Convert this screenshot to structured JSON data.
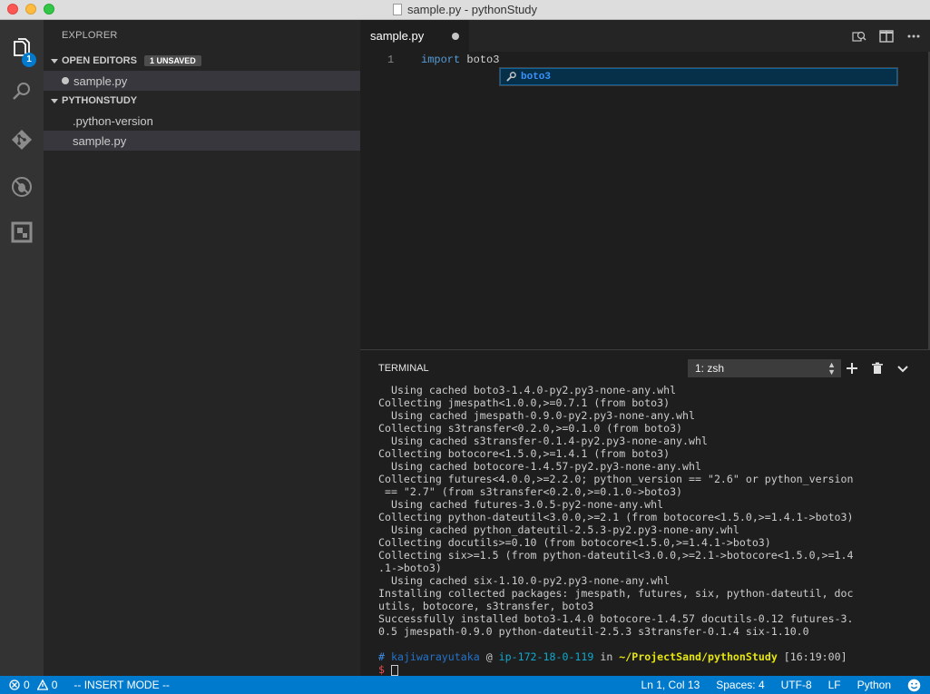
{
  "window": {
    "title": "sample.py - pythonStudy"
  },
  "activity_bar": {
    "explorer_badge": "1"
  },
  "sidebar": {
    "title": "EXPLORER",
    "open_editors": {
      "label": "OPEN EDITORS",
      "badge": "1 UNSAVED",
      "files": [
        "sample.py"
      ]
    },
    "project": {
      "label": "PYTHONSTUDY",
      "files": [
        ".python-version",
        "sample.py"
      ]
    }
  },
  "editor": {
    "tab_label": "sample.py",
    "line_number": "1",
    "code_keyword": "import",
    "code_rest": " boto3",
    "suggestion": "boto3"
  },
  "terminal": {
    "title": "TERMINAL",
    "selected_shell": "1: zsh",
    "output": "  Using cached boto3-1.4.0-py2.py3-none-any.whl\nCollecting jmespath<1.0.0,>=0.7.1 (from boto3)\n  Using cached jmespath-0.9.0-py2.py3-none-any.whl\nCollecting s3transfer<0.2.0,>=0.1.0 (from boto3)\n  Using cached s3transfer-0.1.4-py2.py3-none-any.whl\nCollecting botocore<1.5.0,>=1.4.1 (from boto3)\n  Using cached botocore-1.4.57-py2.py3-none-any.whl\nCollecting futures<4.0.0,>=2.2.0; python_version == \"2.6\" or python_version\n == \"2.7\" (from s3transfer<0.2.0,>=0.1.0->boto3)\n  Using cached futures-3.0.5-py2-none-any.whl\nCollecting python-dateutil<3.0.0,>=2.1 (from botocore<1.5.0,>=1.4.1->boto3)\n  Using cached python_dateutil-2.5.3-py2.py3-none-any.whl\nCollecting docutils>=0.10 (from botocore<1.5.0,>=1.4.1->boto3)\nCollecting six>=1.5 (from python-dateutil<3.0.0,>=2.1->botocore<1.5.0,>=1.4\n.1->boto3)\n  Using cached six-1.10.0-py2.py3-none-any.whl\nInstalling collected packages: jmespath, futures, six, python-dateutil, doc\nutils, botocore, s3transfer, boto3\nSuccessfully installed boto3-1.4.0 botocore-1.4.57 docutils-0.12 futures-3.\n0.5 jmespath-0.9.0 python-dateutil-2.5.3 s3transfer-0.1.4 six-1.10.0",
    "prompt": {
      "hash": "#",
      "user": "kajiwarayutaka",
      "at": "@",
      "host": "ip-172-18-0-119",
      "in": "in",
      "path": "~/ProjectSand/pythonStudy",
      "time": "[16:19:00]",
      "dollar": "$"
    }
  },
  "statusbar": {
    "errors": "0",
    "warnings": "0",
    "mode": "-- INSERT MODE --",
    "position": "Ln 1, Col 13",
    "spaces": "Spaces: 4",
    "encoding": "UTF-8",
    "eol": "LF",
    "language": "Python"
  }
}
